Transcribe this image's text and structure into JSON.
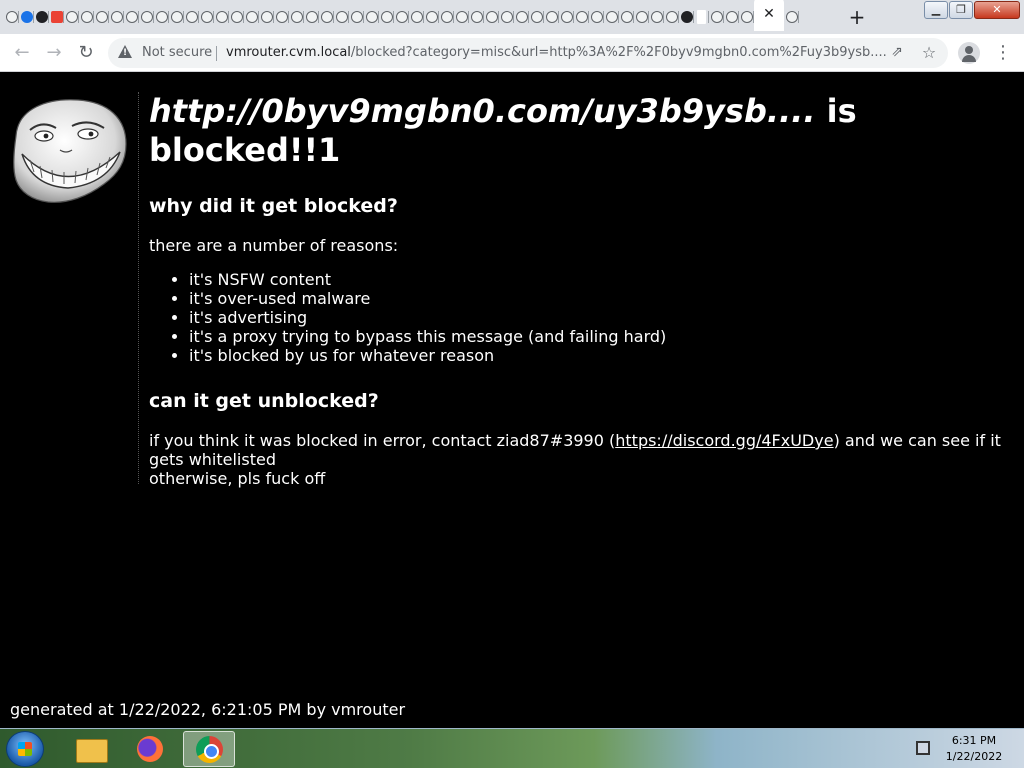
{
  "browser": {
    "tab_close_glyph": "✕",
    "new_tab_glyph": "+",
    "security_label": "Not secure",
    "url_host": "vmrouter.cvm.local",
    "url_path": "/blocked?category=misc&url=http%3A%2F%2F0byv9mgbn0.com%2Fuy3b9ysb...."
  },
  "page": {
    "blocked_url": "http://0byv9mgbn0.com/uy3b9ysb....",
    "blocked_suffix": " is blocked!!1",
    "why_heading": "why did it get blocked?",
    "reasons_intro": "there are a number of reasons:",
    "reasons": [
      "it's NSFW content",
      "it's over-used malware",
      "it's advertising",
      "it's a proxy trying to bypass this message (and failing hard)",
      "it's blocked by us for whatever reason"
    ],
    "unblock_heading": "can it get unblocked?",
    "contact_prefix": "if you think it was blocked in error, contact ziad87#3990 (",
    "contact_link": "https://discord.gg/4FxUDye",
    "contact_suffix": ") and we can see if it gets whitelisted",
    "otherwise": "otherwise, pls fuck off",
    "footer": "generated at 1/22/2022, 6:21:05 PM by vmrouter"
  },
  "taskbar": {
    "time": "6:31 PM",
    "date": "1/22/2022"
  }
}
